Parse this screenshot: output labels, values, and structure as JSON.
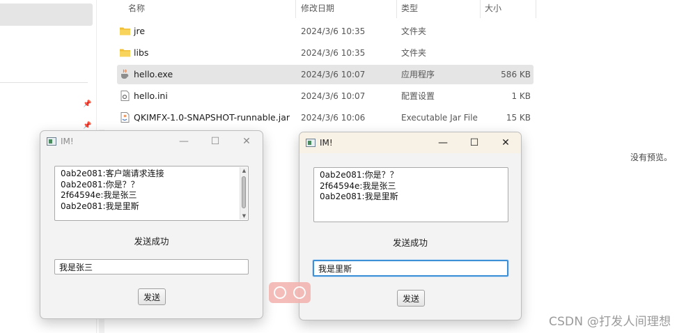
{
  "explorer": {
    "columns": {
      "name": "名称",
      "date": "修改日期",
      "type": "类型",
      "size": "大小"
    },
    "files": [
      {
        "name": "jre",
        "date": "2024/3/6 10:35",
        "type": "文件夹",
        "size": "",
        "icon": "folder-icon"
      },
      {
        "name": "libs",
        "date": "2024/3/6 10:35",
        "type": "文件夹",
        "size": "",
        "icon": "folder-icon"
      },
      {
        "name": "hello.exe",
        "date": "2024/3/6 10:07",
        "type": "应用程序",
        "size": "586 KB",
        "icon": "java-exe-icon",
        "selected": true
      },
      {
        "name": "hello.ini",
        "date": "2024/3/6 10:07",
        "type": "配置设置",
        "size": "1 KB",
        "icon": "config-file-icon"
      },
      {
        "name": "QKIMFX-1.0-SNAPSHOT-runnable.jar",
        "date": "2024/3/6 10:06",
        "type": "Executable Jar File",
        "size": "15 KB",
        "icon": "jar-file-icon"
      }
    ],
    "preview_text": "没有预览。"
  },
  "windows": {
    "left": {
      "title": "IM!",
      "messages": [
        "0ab2e081:客户端请求连接",
        "0ab2e081:你是？？",
        "2f64594e:我是张三",
        "0ab2e081:我是里斯"
      ],
      "status": "发送成功",
      "input_value": "我是张三",
      "send_label": "发送"
    },
    "right": {
      "title": "IM!",
      "messages": [
        "0ab2e081:你是？？",
        "2f64594e:我是张三",
        "0ab2e081:我是里斯"
      ],
      "status": "发送成功",
      "input_value": "我是里斯",
      "send_label": "发送"
    }
  },
  "watermark": "CSDN @打发人间理想",
  "colors": {
    "active_titlebar": "#f8f1e5",
    "focus_border": "#3d8fd6",
    "selection": "#e5e5e5"
  }
}
